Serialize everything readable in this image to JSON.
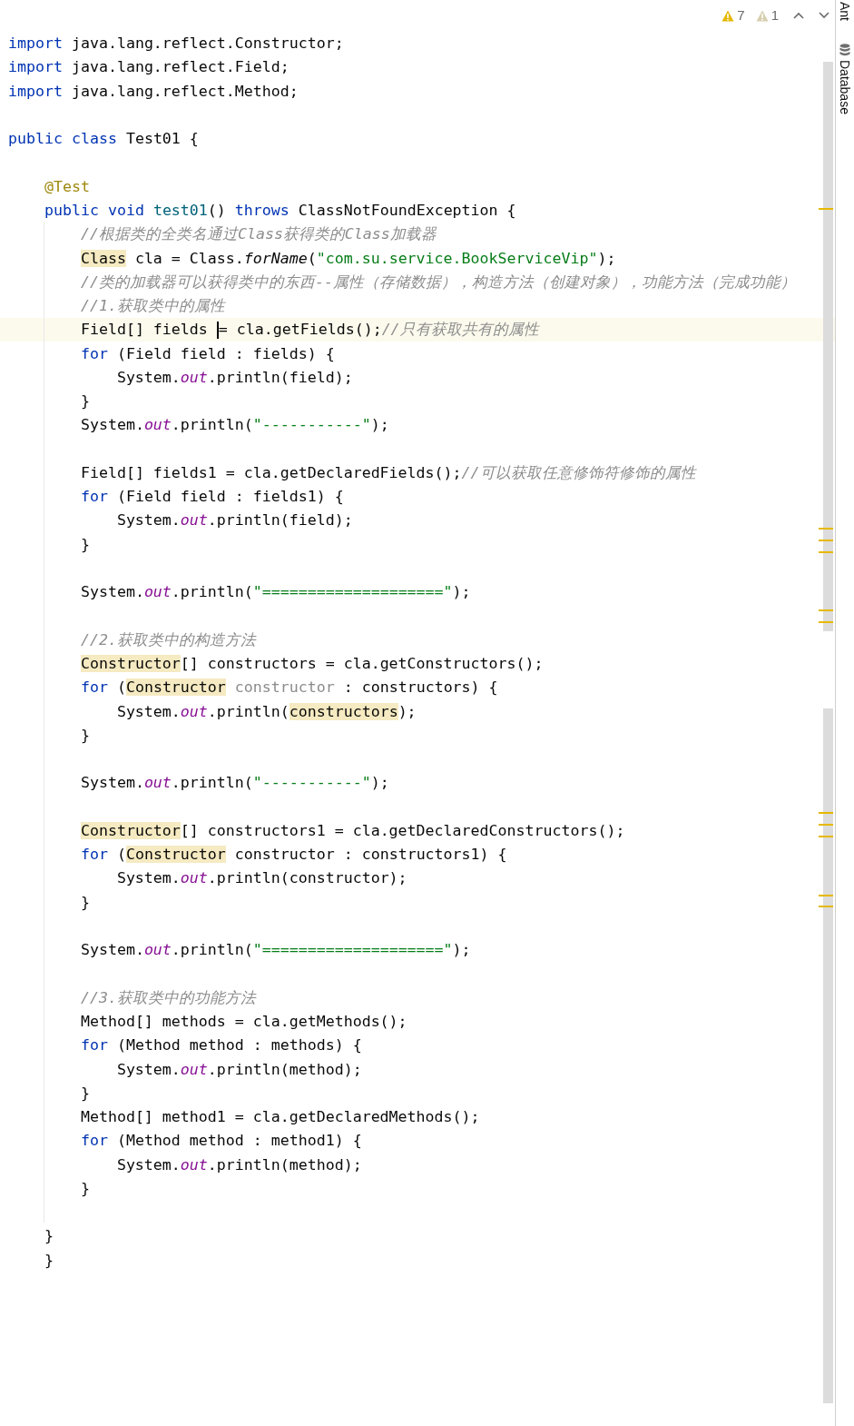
{
  "inspections": {
    "warnings": "7",
    "weak_warnings": "1"
  },
  "tool_windows": [
    {
      "label": "Ant",
      "kind": "text"
    },
    {
      "label": "Database",
      "kind": "database"
    }
  ],
  "lines": [
    {
      "kind": "code",
      "current": false,
      "tokens": [
        {
          "t": "import",
          "kind": "kw"
        },
        {
          "t": " java.lang.reflect.Constructor;",
          "kind": "p"
        }
      ]
    },
    {
      "kind": "code",
      "current": false,
      "tokens": [
        {
          "t": "import",
          "kind": "kw"
        },
        {
          "t": " java.lang.reflect.Field;",
          "kind": "p"
        }
      ]
    },
    {
      "kind": "code",
      "current": false,
      "tokens": [
        {
          "t": "import",
          "kind": "kw"
        },
        {
          "t": " java.lang.reflect.Method;",
          "kind": "p"
        }
      ]
    },
    {
      "kind": "blank",
      "current": false
    },
    {
      "kind": "code",
      "current": false,
      "tokens": [
        {
          "t": "public",
          "kind": "kw"
        },
        {
          "t": " class",
          "kind": "kw"
        },
        {
          "t": " Test01 {",
          "kind": "p"
        }
      ]
    },
    {
      "kind": "blank",
      "current": false
    },
    {
      "kind": "code",
      "current": false,
      "tokens": [
        {
          "t": "    @Test",
          "kind": "a"
        }
      ]
    },
    {
      "kind": "code",
      "current": false,
      "tokens": [
        {
          "t": "    public",
          "kind": "kw"
        },
        {
          "t": " void",
          "kind": "kw"
        },
        {
          "t": " test01",
          "kind": "decl"
        },
        {
          "t": "() ",
          "kind": "p"
        },
        {
          "t": "throws",
          "kind": "kw"
        },
        {
          "t": " ClassNotFoundException {",
          "kind": "p"
        }
      ]
    },
    {
      "kind": "code",
      "current": false,
      "tokens": [
        {
          "t": "        //根据类的全类名通过Class获得类的Class加载器",
          "kind": "c"
        }
      ]
    },
    {
      "kind": "code",
      "current": false,
      "tokens": [
        {
          "t": "        Class",
          "kind": "h"
        },
        {
          "t": " cla = Class.",
          "kind": "p"
        },
        {
          "t": "forName",
          "kind": "i"
        },
        {
          "t": "(",
          "kind": "p"
        },
        {
          "t": "\"com.su.service.BookServiceVip\"",
          "kind": "s"
        },
        {
          "t": ");",
          "kind": "p"
        }
      ]
    },
    {
      "kind": "code",
      "current": false,
      "tokens": [
        {
          "t": "        //类的加载器可以获得类中的东西--属性（存储数据），构造方法（创建对象），功能方法（完成功能）",
          "kind": "c"
        }
      ]
    },
    {
      "kind": "code",
      "current": false,
      "tokens": [
        {
          "t": "        //1.获取类中的属性",
          "kind": "c"
        }
      ]
    },
    {
      "kind": "code",
      "current": true,
      "tokens": [
        {
          "t": "        Field[] fields ",
          "kind": "p"
        },
        {
          "kind": "caret"
        },
        {
          "t": "= cla.getFields();",
          "kind": "p"
        },
        {
          "t": "//只有获取共有的属性",
          "kind": "c"
        }
      ]
    },
    {
      "kind": "code",
      "current": false,
      "tokens": [
        {
          "t": "        for",
          "kind": "kw"
        },
        {
          "t": " (Field field : fields) {",
          "kind": "p"
        }
      ]
    },
    {
      "kind": "code",
      "current": false,
      "tokens": [
        {
          "t": "            System.",
          "kind": "p"
        },
        {
          "t": "out",
          "kind": "sf"
        },
        {
          "t": ".println(field);",
          "kind": "p"
        }
      ]
    },
    {
      "kind": "code",
      "current": false,
      "tokens": [
        {
          "t": "        }",
          "kind": "p"
        }
      ]
    },
    {
      "kind": "code",
      "current": false,
      "tokens": [
        {
          "t": "        System.",
          "kind": "p"
        },
        {
          "t": "out",
          "kind": "sf"
        },
        {
          "t": ".println(",
          "kind": "p"
        },
        {
          "t": "\"-----------\"",
          "kind": "s"
        },
        {
          "t": ");",
          "kind": "p"
        }
      ]
    },
    {
      "kind": "blank",
      "current": false
    },
    {
      "kind": "code",
      "current": false,
      "tokens": [
        {
          "t": "        Field[] fields1 = cla.getDeclaredFields();",
          "kind": "p"
        },
        {
          "t": "//可以获取任意修饰符修饰的属性",
          "kind": "c"
        }
      ]
    },
    {
      "kind": "code",
      "current": false,
      "tokens": [
        {
          "t": "        for",
          "kind": "kw"
        },
        {
          "t": " (Field field : fields1) {",
          "kind": "p"
        }
      ]
    },
    {
      "kind": "code",
      "current": false,
      "tokens": [
        {
          "t": "            System.",
          "kind": "p"
        },
        {
          "t": "out",
          "kind": "sf"
        },
        {
          "t": ".println(field);",
          "kind": "p"
        }
      ]
    },
    {
      "kind": "code",
      "current": false,
      "tokens": [
        {
          "t": "        }",
          "kind": "p"
        }
      ]
    },
    {
      "kind": "blank",
      "current": false
    },
    {
      "kind": "code",
      "current": false,
      "tokens": [
        {
          "t": "        System.",
          "kind": "p"
        },
        {
          "t": "out",
          "kind": "sf"
        },
        {
          "t": ".println(",
          "kind": "p"
        },
        {
          "t": "\"====================\"",
          "kind": "s"
        },
        {
          "t": ");",
          "kind": "p"
        }
      ]
    },
    {
      "kind": "blank",
      "current": false
    },
    {
      "kind": "code",
      "current": false,
      "tokens": [
        {
          "t": "        //2.获取类中的构造方法",
          "kind": "c"
        }
      ]
    },
    {
      "kind": "code",
      "current": false,
      "tokens": [
        {
          "t": "        Constructor",
          "kind": "h"
        },
        {
          "t": "[] constructors = cla.getConstructors();",
          "kind": "p"
        }
      ]
    },
    {
      "kind": "code",
      "current": false,
      "tokens": [
        {
          "t": "        for",
          "kind": "kw"
        },
        {
          "t": " (",
          "kind": "p"
        },
        {
          "t": "Constructor",
          "kind": "h"
        },
        {
          "t": " constructor",
          "kind": "u"
        },
        {
          "t": " : constructors) {",
          "kind": "p"
        }
      ]
    },
    {
      "kind": "code",
      "current": false,
      "tokens": [
        {
          "t": "            System.",
          "kind": "p"
        },
        {
          "t": "out",
          "kind": "sf"
        },
        {
          "t": ".println(",
          "kind": "p"
        },
        {
          "t": "constructors",
          "kind": "h"
        },
        {
          "t": ");",
          "kind": "p"
        }
      ]
    },
    {
      "kind": "code",
      "current": false,
      "tokens": [
        {
          "t": "        }",
          "kind": "p"
        }
      ]
    },
    {
      "kind": "blank",
      "current": false
    },
    {
      "kind": "code",
      "current": false,
      "tokens": [
        {
          "t": "        System.",
          "kind": "p"
        },
        {
          "t": "out",
          "kind": "sf"
        },
        {
          "t": ".println(",
          "kind": "p"
        },
        {
          "t": "\"-----------\"",
          "kind": "s"
        },
        {
          "t": ");",
          "kind": "p"
        }
      ]
    },
    {
      "kind": "blank",
      "current": false
    },
    {
      "kind": "code",
      "current": false,
      "tokens": [
        {
          "t": "        Constructor",
          "kind": "h"
        },
        {
          "t": "[] constructors1 = cla.getDeclaredConstructors();",
          "kind": "p"
        }
      ]
    },
    {
      "kind": "code",
      "current": false,
      "tokens": [
        {
          "t": "        for",
          "kind": "kw"
        },
        {
          "t": " (",
          "kind": "p"
        },
        {
          "t": "Constructor",
          "kind": "h"
        },
        {
          "t": " constructor : constructors1) {",
          "kind": "p"
        }
      ]
    },
    {
      "kind": "code",
      "current": false,
      "tokens": [
        {
          "t": "            System.",
          "kind": "p"
        },
        {
          "t": "out",
          "kind": "sf"
        },
        {
          "t": ".println(constructor);",
          "kind": "p"
        }
      ]
    },
    {
      "kind": "code",
      "current": false,
      "tokens": [
        {
          "t": "        }",
          "kind": "p"
        }
      ]
    },
    {
      "kind": "blank",
      "current": false
    },
    {
      "kind": "code",
      "current": false,
      "tokens": [
        {
          "t": "        System.",
          "kind": "p"
        },
        {
          "t": "out",
          "kind": "sf"
        },
        {
          "t": ".println(",
          "kind": "p"
        },
        {
          "t": "\"====================\"",
          "kind": "s"
        },
        {
          "t": ");",
          "kind": "p"
        }
      ]
    },
    {
      "kind": "blank",
      "current": false
    },
    {
      "kind": "code",
      "current": false,
      "tokens": [
        {
          "t": "        //3.获取类中的功能方法",
          "kind": "c"
        }
      ]
    },
    {
      "kind": "code",
      "current": false,
      "tokens": [
        {
          "t": "        Method[] methods = cla.getMethods();",
          "kind": "p"
        }
      ]
    },
    {
      "kind": "code",
      "current": false,
      "tokens": [
        {
          "t": "        for",
          "kind": "kw"
        },
        {
          "t": " (Method method : methods) {",
          "kind": "p"
        }
      ]
    },
    {
      "kind": "code",
      "current": false,
      "tokens": [
        {
          "t": "            System.",
          "kind": "p"
        },
        {
          "t": "out",
          "kind": "sf"
        },
        {
          "t": ".println(method);",
          "kind": "p"
        }
      ]
    },
    {
      "kind": "code",
      "current": false,
      "tokens": [
        {
          "t": "        }",
          "kind": "p"
        }
      ]
    },
    {
      "kind": "code",
      "current": false,
      "tokens": [
        {
          "t": "        Method[] method1 = cla.getDeclaredMethods();",
          "kind": "p"
        }
      ]
    },
    {
      "kind": "code",
      "current": false,
      "tokens": [
        {
          "t": "        for",
          "kind": "kw"
        },
        {
          "t": " (Method method : method1) {",
          "kind": "p"
        }
      ]
    },
    {
      "kind": "code",
      "current": false,
      "tokens": [
        {
          "t": "            System.",
          "kind": "p"
        },
        {
          "t": "out",
          "kind": "sf"
        },
        {
          "t": ".println(method);",
          "kind": "p"
        }
      ]
    },
    {
      "kind": "code",
      "current": false,
      "tokens": [
        {
          "t": "        }",
          "kind": "p"
        }
      ]
    },
    {
      "kind": "blank",
      "current": false
    },
    {
      "kind": "code",
      "current": false,
      "tokens": [
        {
          "t": "    }",
          "kind": "p"
        }
      ]
    },
    {
      "kind": "code",
      "current": false,
      "tokens": [
        {
          "t": "    }",
          "kind": "p"
        }
      ]
    }
  ]
}
